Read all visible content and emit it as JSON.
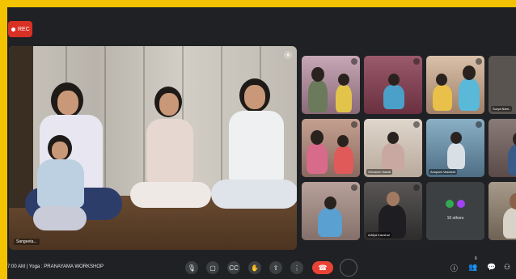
{
  "recording": {
    "label": "REC"
  },
  "main_video": {
    "name": "Sangeeta..."
  },
  "grid": {
    "tiles": [
      {
        "name": "",
        "bg": "#a4788a"
      },
      {
        "name": "",
        "bg": "#8a4c5c"
      },
      {
        "name": "",
        "bg": "#c9a98e"
      },
      {
        "name": "Surya Nam..",
        "bg": "#5a5450"
      },
      {
        "name": "",
        "bg": "#b0897b"
      },
      {
        "name": "Shivansh Nandi",
        "bg": "#d1c6bd"
      },
      {
        "name": "Anupam Vashisht",
        "bg": "#6a8aa0"
      },
      {
        "name": "",
        "bg": "#7a6a68"
      },
      {
        "name": "",
        "bg": "#a08b84"
      },
      {
        "name": "Aditya Kaushal",
        "bg": "#3e3c3c"
      }
    ],
    "others": {
      "label": "16 others"
    }
  },
  "bottom_bar": {
    "meeting_info": "7:00 AM  |  Yoga : PRANAYAMA WORKSHOP",
    "controls": [
      "mic-icon",
      "camera-icon",
      "captions-icon",
      "hand-icon",
      "present-icon",
      "more-icon"
    ],
    "end_call": "leave-call-icon",
    "right_controls": [
      "info-icon",
      "people-icon",
      "chat-icon",
      "activities-icon"
    ],
    "people_count": "6"
  },
  "colors": {
    "accent": "#8ab4f8",
    "end_call": "#ea4335",
    "frame": "#f5c400",
    "background": "#202124"
  }
}
